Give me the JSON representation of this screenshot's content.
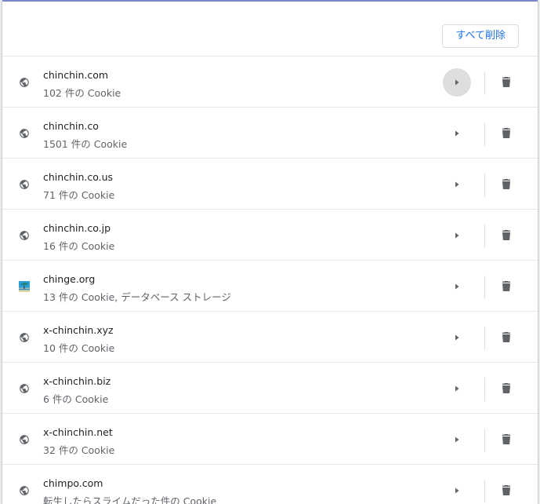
{
  "header": {
    "remove_all_label": "すべて削除"
  },
  "sites": [
    {
      "name": "chinchin.com",
      "detail": "102 件の Cookie",
      "icon": "globe-icon",
      "hover": true
    },
    {
      "name": "chinchin.co",
      "detail": "1501 件の Cookie",
      "icon": "globe-icon",
      "hover": false
    },
    {
      "name": "chinchin.co.us",
      "detail": "71 件の Cookie",
      "icon": "globe-icon",
      "hover": false
    },
    {
      "name": "chinchin.co.jp",
      "detail": "16 件の Cookie",
      "icon": "globe-icon",
      "hover": false
    },
    {
      "name": "chinge.org",
      "detail": "13 件の Cookie, データベース ストレージ",
      "icon": "favicon-image-icon",
      "hover": false
    },
    {
      "name": "x-chinchin.xyz",
      "detail": "10 件の Cookie",
      "icon": "globe-icon",
      "hover": false
    },
    {
      "name": "x-chinchin.biz",
      "detail": "6 件の Cookie",
      "icon": "globe-icon",
      "hover": false
    },
    {
      "name": "x-chinchin.net",
      "detail": "32 件の Cookie",
      "icon": "globe-icon",
      "hover": false
    },
    {
      "name": "chimpo.com",
      "detail": "転生したらスライムだった件の Cookie",
      "icon": "globe-icon",
      "hover": false
    }
  ],
  "colors": {
    "accent": "#1a73e8",
    "icon": "#5f6368",
    "text": "#202124"
  }
}
